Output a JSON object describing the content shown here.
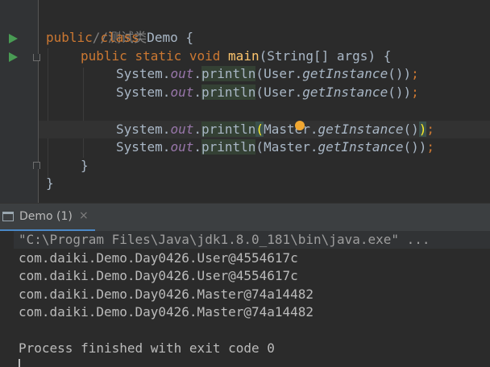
{
  "editor": {
    "comment": "//测试类",
    "class_decl": {
      "kw_public": "public",
      "kw_class": "class",
      "name": "Demo",
      "brace": "{"
    },
    "main_decl": {
      "kw_public": "public",
      "kw_static": "static",
      "kw_void": "void",
      "name": "main",
      "params": "(String[] args)",
      "brace": "{"
    },
    "statements": [
      {
        "receiver": "System.",
        "field": "out",
        "dot": ".",
        "method": "println",
        "open": "(",
        "cls": "User.",
        "call": "getInstance",
        "close": "())",
        "semi": ";"
      },
      {
        "receiver": "System.",
        "field": "out",
        "dot": ".",
        "method": "println",
        "open": "(",
        "cls": "User.",
        "call": "getInstance",
        "close": "())",
        "semi": ";"
      },
      {
        "receiver": "System.",
        "field": "out",
        "dot": ".",
        "method": "println",
        "open": "(",
        "cls": "Master.",
        "call": "getInstance",
        "close_a": "()",
        "close_b": ")",
        "semi": ";"
      },
      {
        "receiver": "System.",
        "field": "out",
        "dot": ".",
        "method": "println",
        "open": "(",
        "cls": "Master.",
        "call": "getInstance",
        "close": "())",
        "semi": ";"
      }
    ],
    "close_method": "}",
    "close_class": "}"
  },
  "run_panel": {
    "tab_label": "Demo (1)",
    "tab_close": "×",
    "output": [
      "\"C:\\Program Files\\Java\\jdk1.8.0_181\\bin\\java.exe\" ...",
      "com.daiki.Demo.Day0426.User@4554617c",
      "com.daiki.Demo.Day0426.User@4554617c",
      "com.daiki.Demo.Day0426.Master@74a14482",
      "com.daiki.Demo.Day0426.Master@74a14482",
      "",
      "Process finished with exit code 0"
    ]
  },
  "colors": {
    "background": "#2b2b2b",
    "keyword": "#cc7832",
    "field": "#9876aa",
    "method_decl": "#ffc66d",
    "text": "#a9b7c6",
    "run_icon": "#499c54",
    "tab_underline": "#4a88c7"
  },
  "icons": [
    "run-icon",
    "fold-icon",
    "console-icon",
    "close-icon",
    "intention-bulb-icon"
  ]
}
